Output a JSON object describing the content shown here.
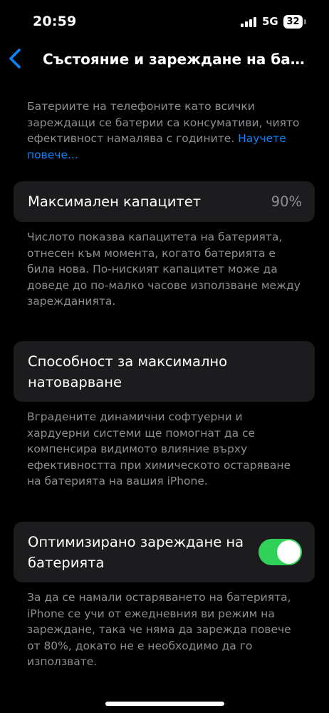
{
  "status_bar": {
    "time": "20:59",
    "network": "5G",
    "battery_level": "32"
  },
  "nav": {
    "title": "Състояние и зареждане на ба…",
    "back_icon": "chevron-left-icon"
  },
  "intro": {
    "text": "Батериите на телефоните като всички зареждащи се батерии са консумативи, чиято ефективност намалява с годините. ",
    "link": "Научете повече..."
  },
  "capacity": {
    "label": "Максимален капацитет",
    "value": "90%",
    "description": "Числото показва капацитета на батерията, отнесен към момента, когато батерията е била нова. По-ниският капацитет може да доведе до по-малко часове използване между зарежданията."
  },
  "peak_performance": {
    "label": "Способност за максимално натоварване",
    "description": "Вградените динамични софтуерни и хардуерни системи ще помогнат да се компенсира видимото влияние върху ефективността при химическото остаряване на батерията на вашия iPhone."
  },
  "optimized_charging": {
    "label": "Оптимизирано зареждане на батерията",
    "enabled": true,
    "description": "За да се намали остаряването на батерията, iPhone се учи от ежедневния ви режим на зареждане, така че няма да зарежда повече от 80%, докато не е необходимо да го използвате."
  },
  "colors": {
    "background": "#000000",
    "card": "#1c1c1e",
    "secondary_text": "#8e8e93",
    "accent": "#0a84ff",
    "toggle_on": "#30d158"
  }
}
